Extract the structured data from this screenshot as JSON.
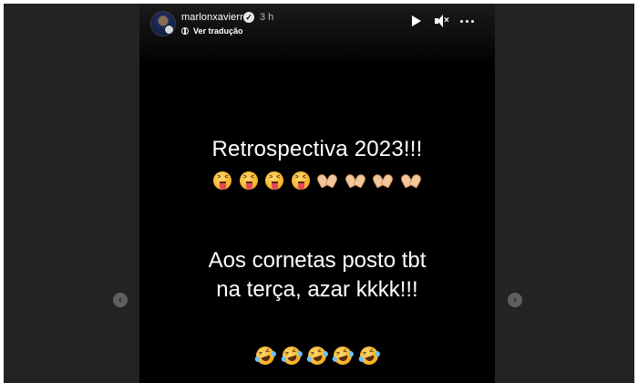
{
  "story": {
    "username": "marlonxavierr",
    "time": "3 h",
    "translate_label": "Ver tradução",
    "headline": "Retrospectiva 2023!!!",
    "body_line_1": "Aos cornetas posto tbt",
    "body_line_2": "na terça, azar kkkk!!!",
    "emoji_row_1": [
      "squinting-tongue-face",
      "squinting-tongue-face",
      "squinting-tongue-face",
      "squinting-tongue-face",
      "heart-hands",
      "heart-hands",
      "heart-hands",
      "heart-hands"
    ],
    "emoji_row_2": [
      "rolling-on-floor-laughing",
      "rolling-on-floor-laughing",
      "rolling-on-floor-laughing",
      "rolling-on-floor-laughing",
      "rolling-on-floor-laughing"
    ]
  },
  "controls": {
    "play_icon": "play-icon",
    "mute_icon": "mute-icon",
    "more_icon": "more-icon"
  },
  "navigation": {
    "prev_icon": "chevron-left-icon",
    "next_icon": "chevron-right-icon",
    "prev_glyph": "‹",
    "next_glyph": "›"
  },
  "colors": {
    "story_bg": "#000000",
    "backdrop": "#232323",
    "text": "#ffffff"
  }
}
